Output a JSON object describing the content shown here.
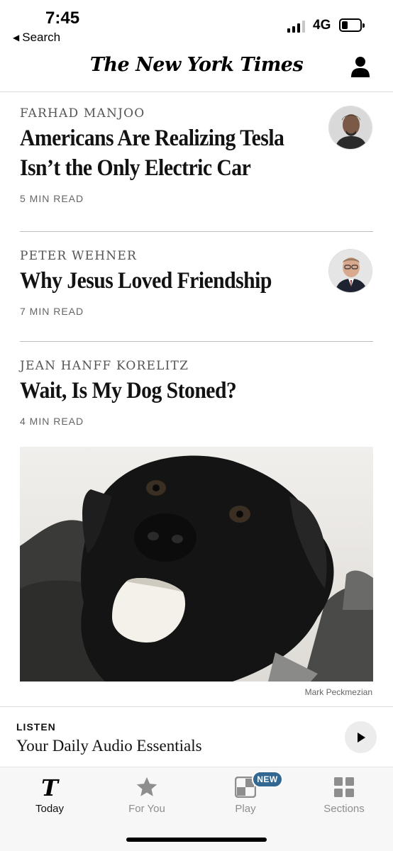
{
  "status": {
    "time": "7:45",
    "back_label": "Search",
    "network": "4G"
  },
  "masthead": {
    "logo": "The New York Times"
  },
  "articles": [
    {
      "byline": "FARHAD MANJOO",
      "headline": "Americans Are Realizing Tesla Isn’t the Only Electric Car",
      "read_time": "5 MIN READ"
    },
    {
      "byline": "PETER WEHNER",
      "headline": "Why Jesus Loved Friendship",
      "read_time": "7 MIN READ"
    },
    {
      "byline": "JEAN HANFF KORELITZ",
      "headline": "Wait, Is My Dog Stoned?",
      "read_time": "4 MIN READ",
      "photo_credit": "Mark Peckmezian"
    }
  ],
  "listen": {
    "kicker": "LISTEN",
    "title": "Your Daily Audio Essentials"
  },
  "tabs": [
    {
      "label": "Today",
      "icon": "nyt-t-icon",
      "active": true
    },
    {
      "label": "For You",
      "icon": "star-icon",
      "active": false
    },
    {
      "label": "Play",
      "icon": "games-icon",
      "active": false,
      "badge": "NEW"
    },
    {
      "label": "Sections",
      "icon": "grid-icon",
      "active": false
    }
  ],
  "colors": {
    "badge": "#326891",
    "text": "#121212",
    "muted": "#8e8e8e"
  }
}
